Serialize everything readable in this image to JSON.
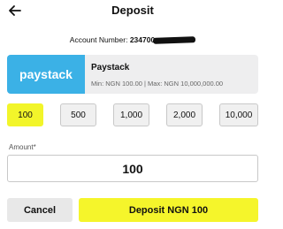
{
  "header": {
    "title": "Deposit",
    "back_icon": "arrow-left-icon"
  },
  "account": {
    "label": "Account Number:",
    "number_visible": "234700"
  },
  "provider": {
    "logo_text": "paystack",
    "name": "Paystack",
    "limits": "Min: NGN 100.00 | Max: NGN 10,000,000.00",
    "logo_color": "#3bb1e6"
  },
  "quick_amounts": [
    "100",
    "500",
    "1,000",
    "2,000",
    "10,000"
  ],
  "selected_amount": "100",
  "amount_field": {
    "label": "Amount*",
    "value": "100"
  },
  "actions": {
    "cancel": "Cancel",
    "deposit": "Deposit NGN 100"
  },
  "colors": {
    "accent": "#f5f52b",
    "neutral": "#e8e8e8"
  }
}
